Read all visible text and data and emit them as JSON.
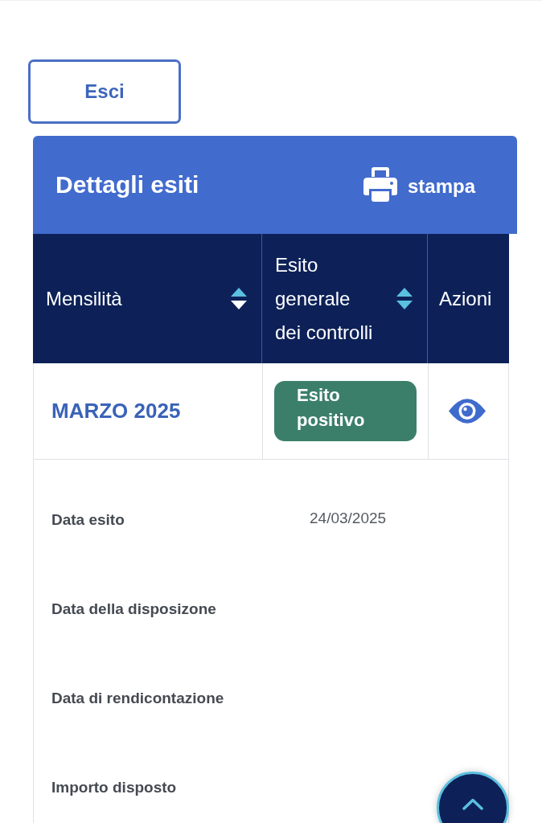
{
  "exit_button": {
    "label": "Esci"
  },
  "panel": {
    "title": "Dettagli esiti",
    "print_button": {
      "label": "stampa"
    }
  },
  "table": {
    "columns": [
      {
        "label": "Mensilità",
        "sortable": true,
        "sorted": true
      },
      {
        "label": "Esito generale dei controlli",
        "sortable": true,
        "sorted": false
      },
      {
        "label": "Azioni",
        "sortable": false
      }
    ],
    "rows": [
      {
        "month": "MARZO 2025",
        "outcome": {
          "label": "Esito positivo",
          "kind": "positive"
        },
        "expanded": true,
        "details": [
          {
            "label": "Data esito",
            "value": "24/03/2025"
          },
          {
            "label": "Data della disposizone"
          },
          {
            "label": "Data di rendicontazione"
          },
          {
            "label": "Importo disposto"
          }
        ]
      }
    ]
  }
}
